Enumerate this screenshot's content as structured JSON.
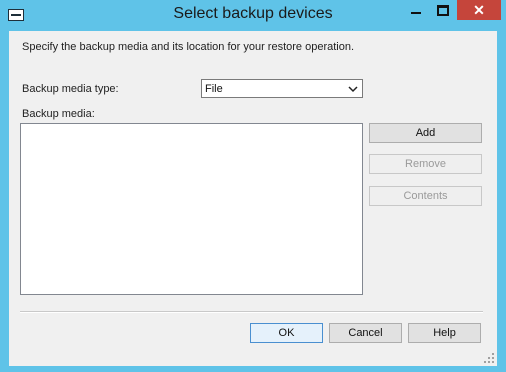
{
  "window": {
    "title": "Select backup devices",
    "close_glyph": "✕"
  },
  "dialog": {
    "description": "Specify the backup media and its location for your restore operation.",
    "media_type_label": "Backup media type:",
    "media_type_value": "File",
    "media_list_label": "Backup media:",
    "media_items": []
  },
  "buttons": {
    "add": "Add",
    "remove": "Remove",
    "contents": "Contents",
    "ok": "OK",
    "cancel": "Cancel",
    "help": "Help"
  },
  "icons": {
    "window": "window-icon",
    "minimize": "minimize-icon",
    "maximize": "maximize-icon",
    "close": "close-icon",
    "dropdown": "chevron-down-icon",
    "resize": "resize-grip-icon"
  },
  "colors": {
    "titlebar": "#5fc3e8",
    "close_button": "#c5453b",
    "dialog_bg": "#f0f0f0"
  }
}
